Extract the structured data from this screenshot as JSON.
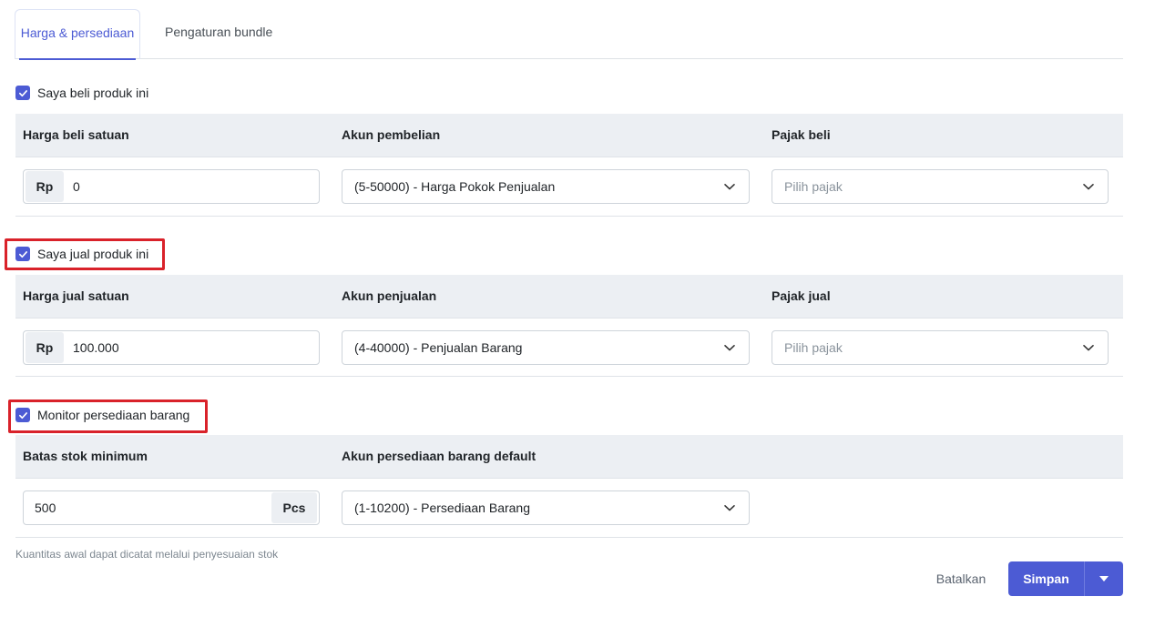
{
  "tabs": [
    {
      "label": "Harga & persediaan",
      "active": true
    },
    {
      "label": "Pengaturan bundle",
      "active": false
    }
  ],
  "purchase": {
    "checkbox_label": "Saya beli produk ini",
    "checked": true,
    "headers": {
      "price": "Harga beli satuan",
      "account": "Akun pembelian",
      "tax": "Pajak beli"
    },
    "currency_prefix": "Rp",
    "price_value": "0",
    "account_value": "(5-50000) - Harga Pokok Penjualan",
    "tax_placeholder": "Pilih pajak"
  },
  "sales": {
    "checkbox_label": "Saya jual produk ini",
    "checked": true,
    "headers": {
      "price": "Harga jual satuan",
      "account": "Akun penjualan",
      "tax": "Pajak jual"
    },
    "currency_prefix": "Rp",
    "price_value": "100.000",
    "account_value": "(4-40000) - Penjualan Barang",
    "tax_placeholder": "Pilih pajak"
  },
  "inventory": {
    "checkbox_label": "Monitor persediaan barang",
    "checked": true,
    "headers": {
      "min_stock": "Batas stok minimum",
      "account": "Akun persediaan barang default"
    },
    "min_stock_value": "500",
    "unit_suffix": "Pcs",
    "account_value": "(1-10200) - Persediaan Barang",
    "note": "Kuantitas awal dapat dicatat melalui penyesuaian stok"
  },
  "footer": {
    "cancel_label": "Batalkan",
    "save_label": "Simpan"
  },
  "colors": {
    "accent": "#4c5bd4",
    "highlight": "#d9222a",
    "band": "#eceff3"
  },
  "icons": {
    "checkbox": "check-icon",
    "select": "chevron-down-icon",
    "save_menu": "caret-down-icon"
  }
}
